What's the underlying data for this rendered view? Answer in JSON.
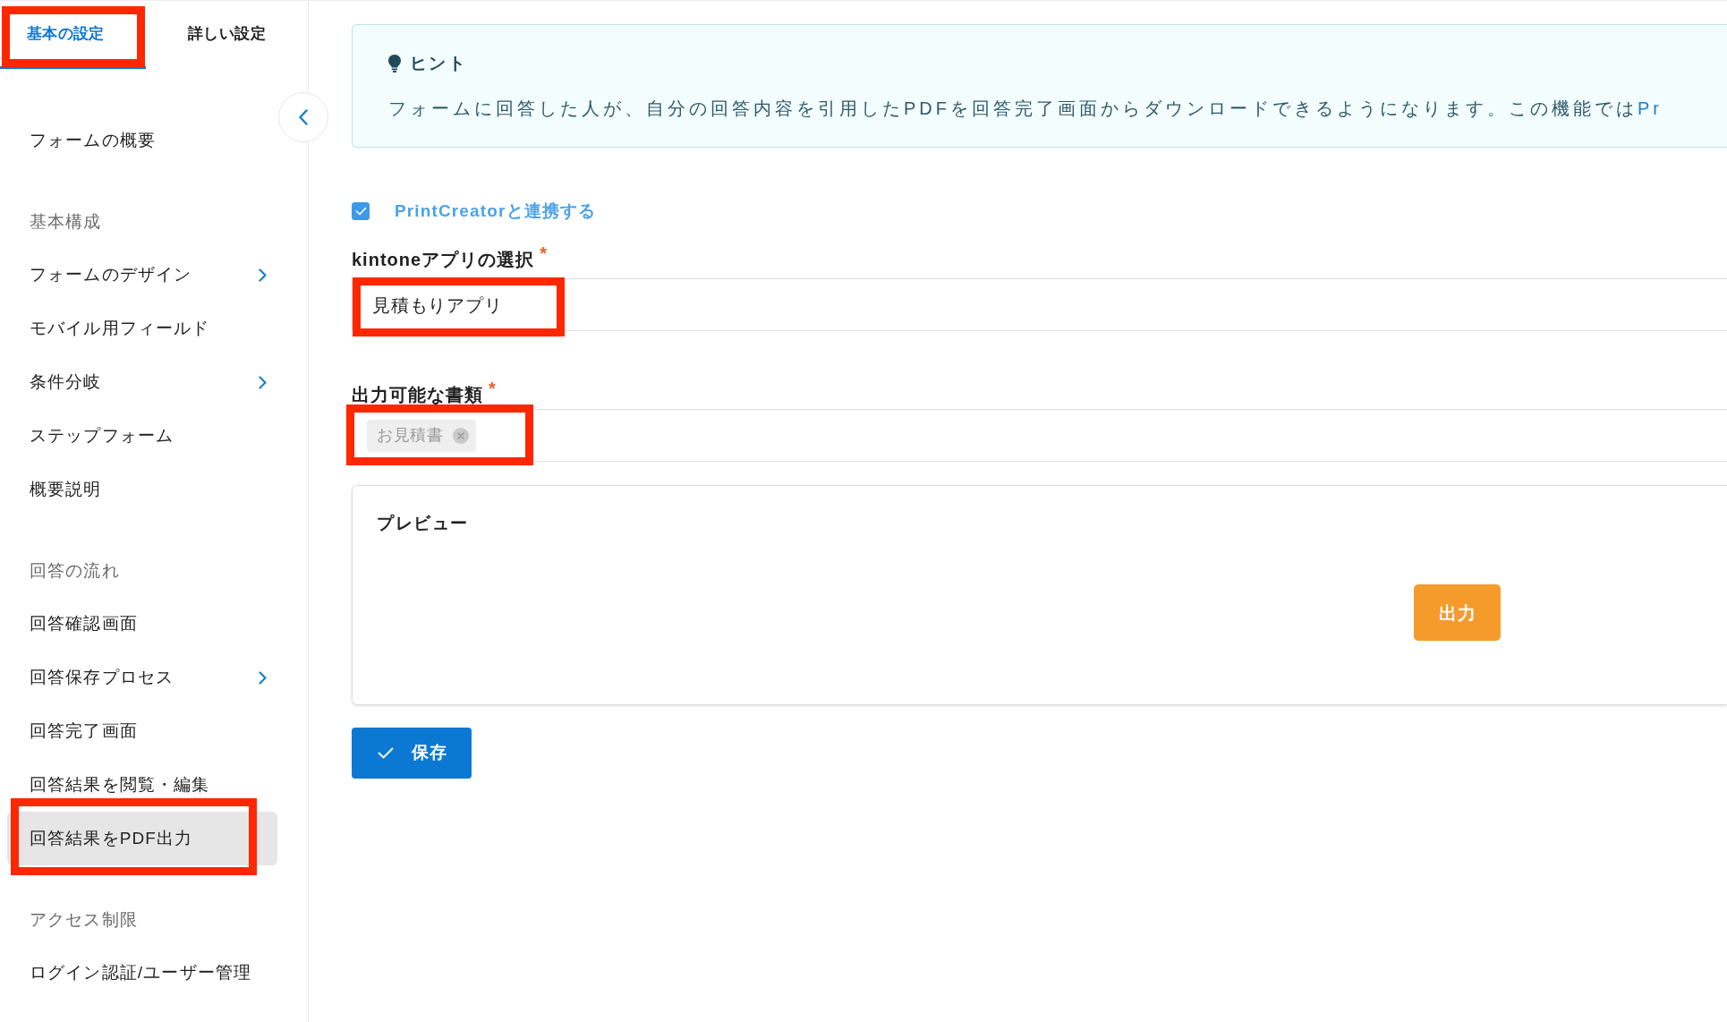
{
  "sidebar": {
    "tabs": [
      {
        "label": "基本の設定",
        "selected": true,
        "annotated": true
      },
      {
        "label": "詳しい設定",
        "selected": false,
        "annotated": false
      }
    ],
    "sections": [
      {
        "items": [
          {
            "label": "フォームの概要",
            "submenu": false,
            "selected": false,
            "annotated": false
          }
        ]
      },
      {
        "heading": "基本構成",
        "items": [
          {
            "label": "フォームのデザイン",
            "submenu": true,
            "selected": false,
            "annotated": false
          },
          {
            "label": "モバイル用フィールド",
            "submenu": false,
            "selected": false,
            "annotated": false
          },
          {
            "label": "条件分岐",
            "submenu": true,
            "selected": false,
            "annotated": false
          },
          {
            "label": "ステップフォーム",
            "submenu": false,
            "selected": false,
            "annotated": false
          },
          {
            "label": "概要説明",
            "submenu": false,
            "selected": false,
            "annotated": false
          }
        ]
      },
      {
        "heading": "回答の流れ",
        "items": [
          {
            "label": "回答確認画面",
            "submenu": false,
            "selected": false,
            "annotated": false
          },
          {
            "label": "回答保存プロセス",
            "submenu": true,
            "selected": false,
            "annotated": false
          },
          {
            "label": "回答完了画面",
            "submenu": false,
            "selected": false,
            "annotated": false
          },
          {
            "label": "回答結果を閲覧・編集",
            "submenu": false,
            "selected": false,
            "annotated": false
          },
          {
            "label": "回答結果をPDF出力",
            "submenu": false,
            "selected": true,
            "annotated": true
          }
        ]
      },
      {
        "heading": "アクセス制限",
        "items": [
          {
            "label": "ログイン認証/ユーザー管理",
            "submenu": false,
            "selected": false,
            "annotated": false
          }
        ]
      }
    ]
  },
  "hint": {
    "title": "ヒント",
    "text": "フォームに回答した人が、自分の回答内容を引用したPDFを回答完了画面からダウンロードできるようになります。この機能では",
    "link": "Pr"
  },
  "integration": {
    "label": "PrintCreatorと連携する",
    "checked": true
  },
  "fields": [
    {
      "kind": "select",
      "label": "kintoneアプリの選択",
      "required_mark": "*",
      "value": "見積もりアプリ",
      "annotated": true
    },
    {
      "kind": "tags",
      "label": "出力可能な書類",
      "required_mark": "*",
      "tags": [
        "お見積書"
      ],
      "annotated": true
    }
  ],
  "preview": {
    "title": "プレビュー",
    "button": "出力"
  },
  "save_button": "保存"
}
